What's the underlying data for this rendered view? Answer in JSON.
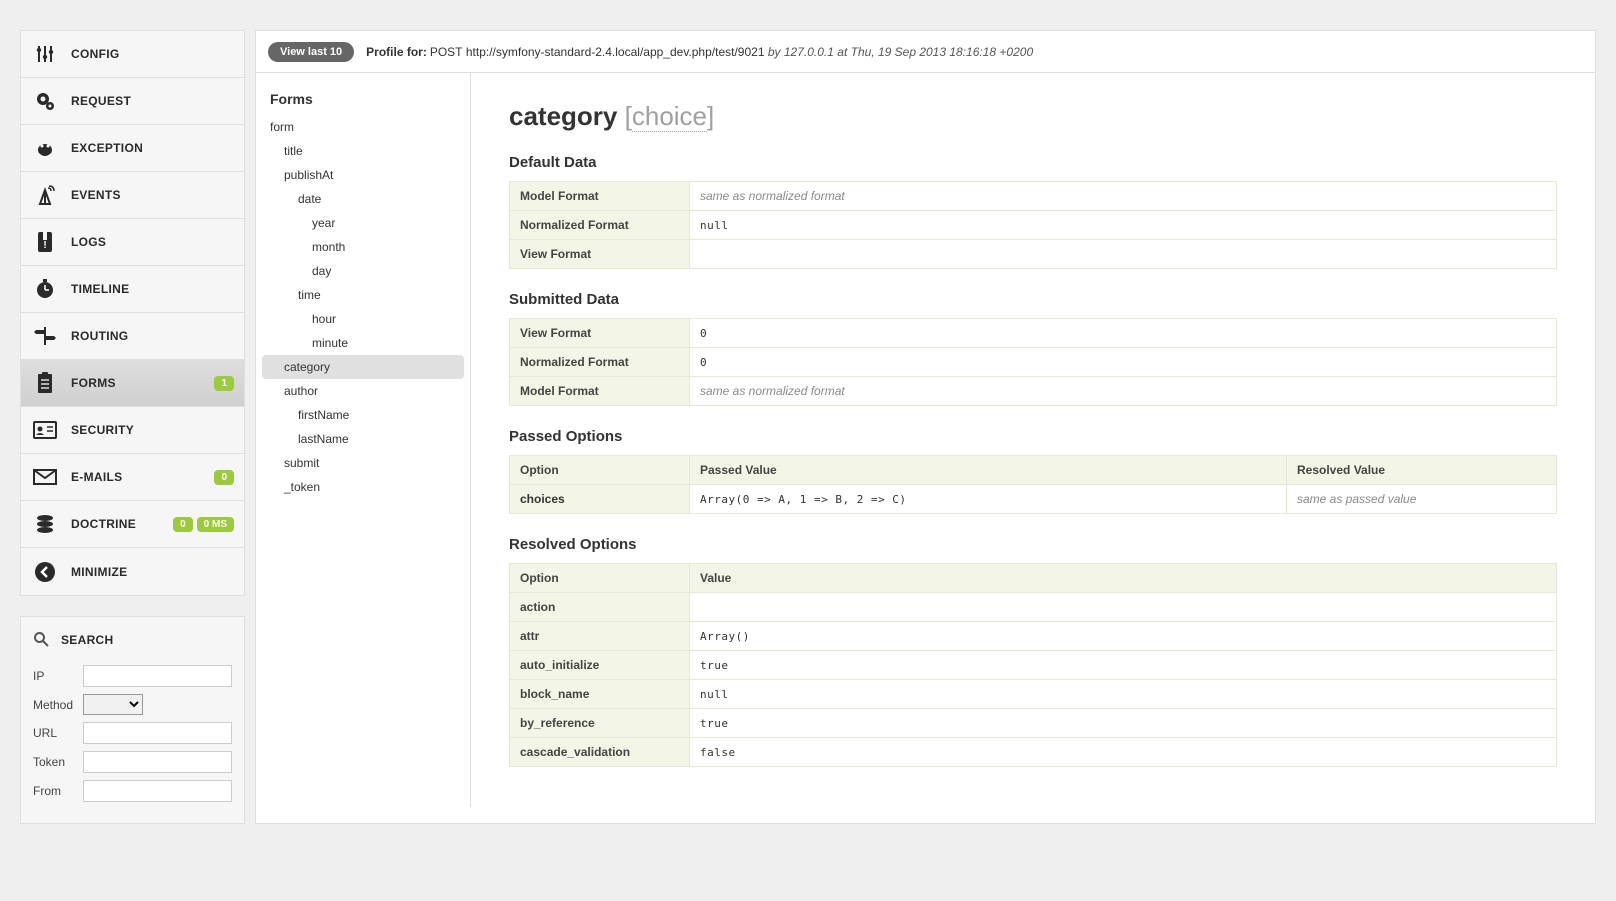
{
  "sidebar": {
    "items": [
      {
        "label": "CONFIG",
        "icon": "sliders"
      },
      {
        "label": "REQUEST",
        "icon": "gear"
      },
      {
        "label": "EXCEPTION",
        "icon": "bug"
      },
      {
        "label": "EVENTS",
        "icon": "antenna"
      },
      {
        "label": "LOGS",
        "icon": "book"
      },
      {
        "label": "TIMELINE",
        "icon": "clock"
      },
      {
        "label": "ROUTING",
        "icon": "signpost"
      },
      {
        "label": "FORMS",
        "icon": "clipboard",
        "badge": "1",
        "active": true
      },
      {
        "label": "SECURITY",
        "icon": "id"
      },
      {
        "label": "E-MAILS",
        "icon": "mail",
        "badge": "0"
      },
      {
        "label": "DOCTRINE",
        "icon": "db",
        "badge": "0",
        "badge2": "0 MS"
      },
      {
        "label": "MINIMIZE",
        "icon": "chevron-left"
      }
    ]
  },
  "search": {
    "title": "SEARCH",
    "fields": {
      "ip": "IP",
      "method": "Method",
      "url": "URL",
      "token": "Token",
      "from": "From"
    }
  },
  "header": {
    "view_last": "View last 10",
    "profile_for": "Profile for:",
    "method": "POST",
    "url": "http://symfony-standard-2.4.local/app_dev.php/test/9021",
    "by": "by",
    "ip": "127.0.0.1",
    "at": "at",
    "date": "Thu, 19 Sep 2013 18:16:18 +0200"
  },
  "form_tree": {
    "title": "Forms",
    "items": [
      {
        "label": "form",
        "indent": 0
      },
      {
        "label": "title",
        "indent": 1
      },
      {
        "label": "publishAt",
        "indent": 1
      },
      {
        "label": "date",
        "indent": 2
      },
      {
        "label": "year",
        "indent": 3
      },
      {
        "label": "month",
        "indent": 3
      },
      {
        "label": "day",
        "indent": 3
      },
      {
        "label": "time",
        "indent": 2
      },
      {
        "label": "hour",
        "indent": 3
      },
      {
        "label": "minute",
        "indent": 3
      },
      {
        "label": "category",
        "indent": 1,
        "active": true
      },
      {
        "label": "author",
        "indent": 1
      },
      {
        "label": "firstName",
        "indent": 2
      },
      {
        "label": "lastName",
        "indent": 2
      },
      {
        "label": "submit",
        "indent": 1
      },
      {
        "label": "_token",
        "indent": 1
      }
    ]
  },
  "main": {
    "title_name": "category",
    "title_type": "choice",
    "sections": {
      "default_data": {
        "heading": "Default Data",
        "rows": [
          {
            "k": "Model Format",
            "v": "same as normalized format",
            "note": true
          },
          {
            "k": "Normalized Format",
            "v": "null",
            "mono": true
          },
          {
            "k": "View Format",
            "v": ""
          }
        ]
      },
      "submitted_data": {
        "heading": "Submitted Data",
        "rows": [
          {
            "k": "View Format",
            "v": "0",
            "mono": true
          },
          {
            "k": "Normalized Format",
            "v": "0",
            "mono": true
          },
          {
            "k": "Model Format",
            "v": "same as normalized format",
            "note": true
          }
        ]
      },
      "passed_options": {
        "heading": "Passed Options",
        "headers": [
          "Option",
          "Passed Value",
          "Resolved Value"
        ],
        "rows": [
          {
            "option": "choices",
            "passed": "Array(0 => A, 1 => B, 2 => C)",
            "resolved": "same as passed value",
            "resolved_note": true
          }
        ]
      },
      "resolved_options": {
        "heading": "Resolved Options",
        "headers": [
          "Option",
          "Value"
        ],
        "rows": [
          {
            "k": "action",
            "v": ""
          },
          {
            "k": "attr",
            "v": "Array()"
          },
          {
            "k": "auto_initialize",
            "v": "true"
          },
          {
            "k": "block_name",
            "v": "null"
          },
          {
            "k": "by_reference",
            "v": "true"
          },
          {
            "k": "cascade_validation",
            "v": "false"
          }
        ]
      }
    }
  }
}
